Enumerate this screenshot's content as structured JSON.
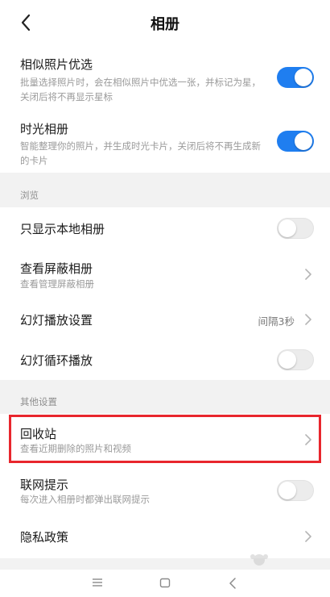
{
  "header": {
    "title": "相册"
  },
  "settings": {
    "similar": {
      "title": "相似照片优选",
      "subtitle": "批量选择照片时，会在相似照片中优选一张，并标记为星，关闭后将不再显示星标",
      "enabled": true
    },
    "timelapse": {
      "title": "时光相册",
      "subtitle": "智能整理你的照片，并生成时光卡片，关闭后将不再生成新的卡片",
      "enabled": true
    },
    "browse": {
      "label": "浏览",
      "local_only": {
        "title": "只显示本地相册",
        "enabled": false
      },
      "hidden": {
        "title": "查看屏蔽相册",
        "subtitle": "查看管理屏蔽相册"
      },
      "slideshow": {
        "title": "幻灯播放设置",
        "value": "间隔3秒"
      },
      "loop": {
        "title": "幻灯循环播放",
        "enabled": false
      }
    },
    "other": {
      "label": "其他设置",
      "recycle": {
        "title": "回收站",
        "subtitle": "查看近期删除的照片和视频"
      },
      "network": {
        "title": "联网提示",
        "subtitle": "每次进入相册时都弹出联网提示",
        "enabled": false
      },
      "privacy": {
        "title": "隐私政策"
      }
    }
  },
  "icons": {
    "back": "chevron-left-icon",
    "chevron": "chevron-right-icon",
    "menu": "menu-icon",
    "home": "home-icon",
    "nav_back": "nav-back-icon"
  },
  "colors": {
    "toggle_on": "#1f7ef0",
    "highlight": "#e8262d"
  }
}
